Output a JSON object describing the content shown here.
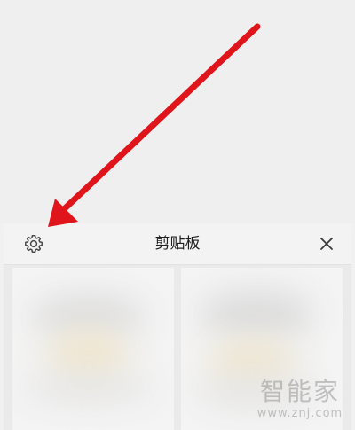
{
  "clipboard": {
    "title": "剪贴板",
    "icons": {
      "settings": "gear-icon",
      "close": "close-icon"
    }
  },
  "watermark": {
    "main": "智能家",
    "url": "www.znj.com"
  },
  "colors": {
    "annotation_arrow": "#e0141b",
    "header_bg": "#f3f3f3",
    "panel_bg": "#eaeaea"
  }
}
